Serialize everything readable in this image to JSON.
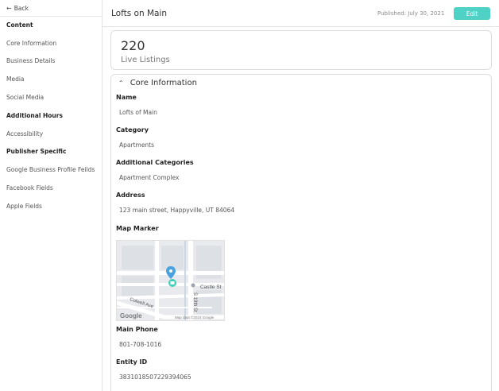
{
  "sidebar": {
    "back_label": "Back",
    "items": [
      {
        "label": "Content",
        "bold": true
      },
      {
        "label": "Core Information",
        "bold": false
      },
      {
        "label": "Business Details",
        "bold": false
      },
      {
        "label": "Media",
        "bold": false
      },
      {
        "label": "Social Media",
        "bold": false
      },
      {
        "label": "Additional Hours",
        "bold": true
      },
      {
        "label": "Accessibility",
        "bold": false
      },
      {
        "label": "Publisher Specific",
        "bold": true
      },
      {
        "label": "Google Business Profile Feilds",
        "bold": false
      },
      {
        "label": "Facebook Fields",
        "bold": false
      },
      {
        "label": "Apple Fields",
        "bold": false
      }
    ]
  },
  "header": {
    "title": "Lofts on Main",
    "published": "Published: July 30, 2021",
    "edit_label": "Edit"
  },
  "listings": {
    "count": "220",
    "label": "Live Listings"
  },
  "core": {
    "title": "Core Information",
    "fields": [
      {
        "label": "Name",
        "value": "Lofts of Main"
      },
      {
        "label": "Category",
        "value": "Apartments"
      },
      {
        "label": "Additional Categories",
        "value": "Apartment Complex"
      },
      {
        "label": "Address",
        "value": "123 main street, Happyville, UT 84064"
      },
      {
        "label": "Map Marker",
        "value": ""
      },
      {
        "label": "Main Phone",
        "value": "801-708-1016"
      },
      {
        "label": "Entity ID",
        "value": "3831018507229394065"
      }
    ],
    "map": {
      "street_1": "Castle St",
      "street_2": "S 19th St",
      "street_3": "Colwell Ave",
      "logo": "Google",
      "attribution": "Map data ©2024 Google"
    }
  },
  "colors": {
    "accent": "#4fd1c5",
    "marker_blue": "#4aa3df",
    "marker_teal": "#3fcfb8"
  }
}
